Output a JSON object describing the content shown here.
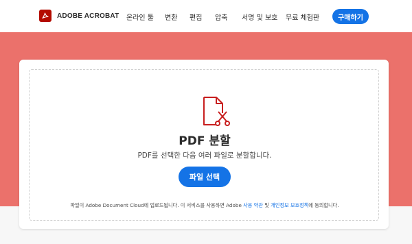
{
  "header": {
    "brand": "ADOBE ACROBAT",
    "nav": [
      "온라인 툴",
      "변환",
      "편집",
      "압축",
      "서명 및 보호",
      "무료 체험판"
    ],
    "buy_label": "구매하기"
  },
  "colors": {
    "hero_bg": "#eb716b",
    "accent": "#1473e6",
    "brand_red": "#b30b00"
  },
  "tool": {
    "icon": "pdf-split-scissors-icon",
    "title": "PDF 분할",
    "subtitle": "PDF를 선택한 다음 여러 파일로 분할합니다.",
    "select_label": "파일 선택"
  },
  "footer_note": {
    "part1": "파일이 Adobe Document Cloud에 업로드됩니다.  이 서비스를 사용하면 Adobe ",
    "terms_link": "사용 약관",
    "part2": " 및 ",
    "privacy_link": "개인정보 보호정책",
    "part3": "에 동의합니다."
  }
}
